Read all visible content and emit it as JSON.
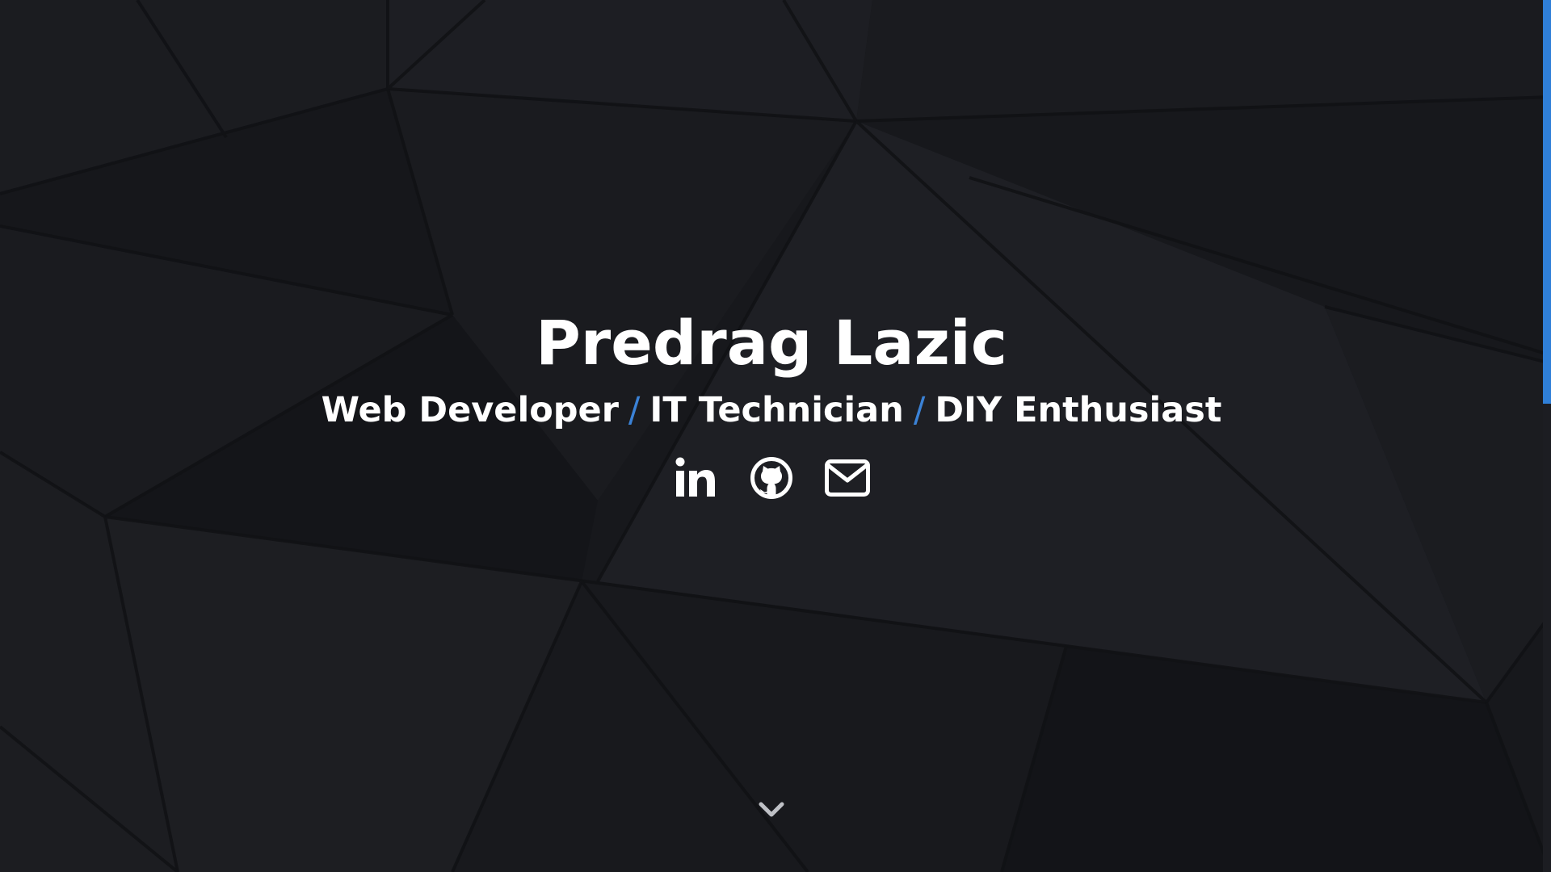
{
  "hero": {
    "name": "Predrag Lazic",
    "roles": [
      "Web Developer",
      "IT Technician",
      "DIY Enthusiast"
    ],
    "separator": "/"
  },
  "social": [
    {
      "icon": "linkedin-icon"
    },
    {
      "icon": "github-icon"
    },
    {
      "icon": "envelope-icon"
    }
  ],
  "scroll": {
    "icon": "chevron-down-icon"
  },
  "colors": {
    "background": "#17181c",
    "accent": "#3b82d6",
    "text": "#ffffff",
    "scrollbar": "#2f7fd8"
  }
}
